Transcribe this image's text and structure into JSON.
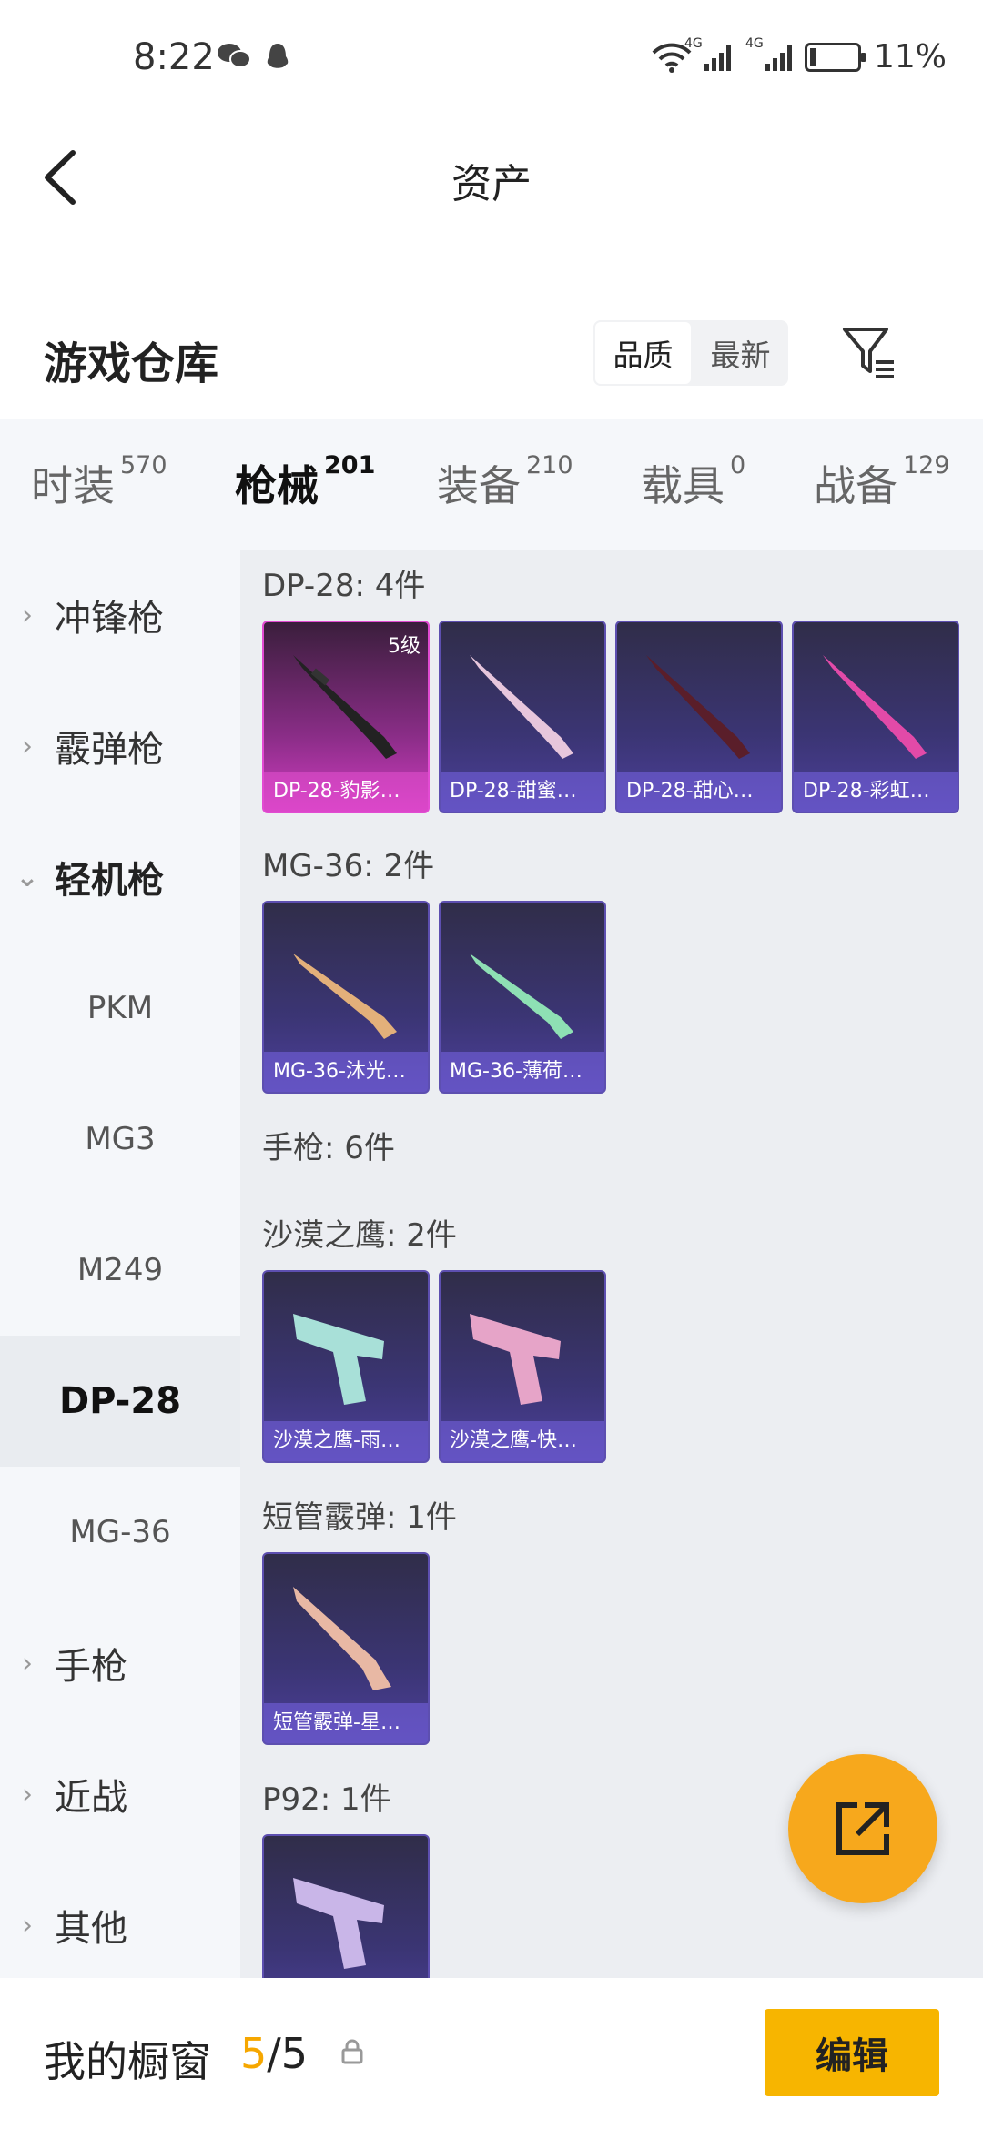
{
  "status": {
    "time": "8:22",
    "battery": "11%",
    "network1": "4G",
    "network2": "4G"
  },
  "header": {
    "title": "资产"
  },
  "warehouse": {
    "title": "游戏仓库",
    "sort_options": [
      "品质",
      "最新"
    ]
  },
  "tabs": [
    {
      "label": "时装",
      "count": "570"
    },
    {
      "label": "枪械",
      "count": "201"
    },
    {
      "label": "装备",
      "count": "210"
    },
    {
      "label": "载具",
      "count": "0"
    },
    {
      "label": "战备",
      "count": "129"
    }
  ],
  "sidebar": [
    {
      "label": "冲锋枪"
    },
    {
      "label": "霰弹枪"
    },
    {
      "label": "轻机枪"
    },
    {
      "label": "PKM"
    },
    {
      "label": "MG3"
    },
    {
      "label": "M249"
    },
    {
      "label": "DP-28"
    },
    {
      "label": "MG-36"
    },
    {
      "label": "手枪"
    },
    {
      "label": "近战"
    },
    {
      "label": "其他"
    }
  ],
  "groups": [
    {
      "title": "DP-28: 4件",
      "items": [
        {
          "name": "DP-28-豹影…",
          "level": "5级"
        },
        {
          "name": "DP-28-甜蜜…"
        },
        {
          "name": "DP-28-甜心…"
        },
        {
          "name": "DP-28-彩虹…"
        }
      ]
    },
    {
      "title": "MG-36: 2件",
      "items": [
        {
          "name": "MG-36-沐光…"
        },
        {
          "name": "MG-36-薄荷…"
        }
      ]
    },
    {
      "title": "手枪: 6件",
      "items": []
    },
    {
      "title": "沙漠之鹰: 2件",
      "items": [
        {
          "name": "沙漠之鹰-雨…"
        },
        {
          "name": "沙漠之鹰-快…"
        }
      ]
    },
    {
      "title": "短管霰弹: 1件",
      "items": [
        {
          "name": "短管霰弹-星…"
        }
      ]
    },
    {
      "title": "P92: 1件",
      "items": []
    }
  ],
  "bottom": {
    "showcase_label": "我的橱窗",
    "count_current": "5",
    "count_total": "/5",
    "edit_label": "编辑"
  },
  "colors": {
    "accent": "#f6a700",
    "card_purple": "#3b3574",
    "card_pink": "#d03cc0"
  }
}
